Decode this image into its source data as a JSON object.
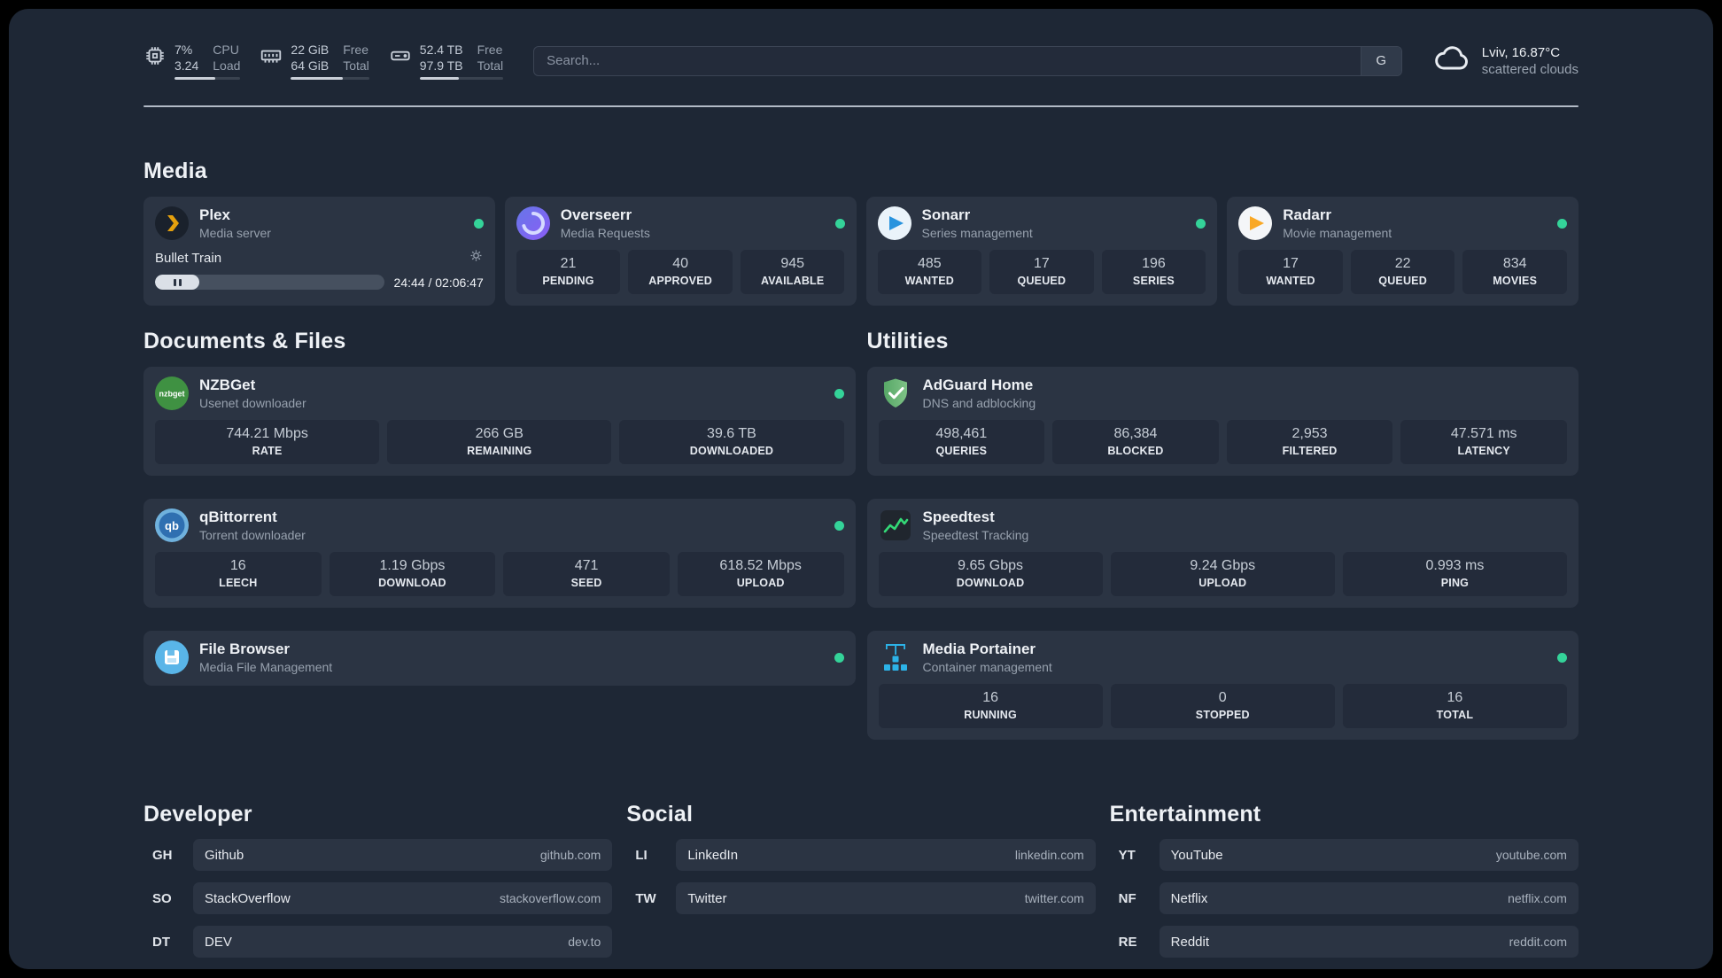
{
  "topbar": {
    "cpu": {
      "value1": "7%",
      "value2": "3.24",
      "label1": "CPU",
      "label2": "Load",
      "bar_pct": 62
    },
    "memory": {
      "value1": "22 GiB",
      "value2": "64 GiB",
      "label1": "Free",
      "label2": "Total",
      "bar_pct": 66
    },
    "disk": {
      "value1": "52.4 TB",
      "value2": "97.9 TB",
      "label1": "Free",
      "label2": "Total",
      "bar_pct": 47
    },
    "search": {
      "placeholder": "Search...",
      "provider_label": "G"
    },
    "weather": {
      "location": "Lviv, 16.87°C",
      "condition": "scattered clouds"
    }
  },
  "sections": {
    "media": {
      "title": "Media"
    },
    "documents": {
      "title": "Documents & Files"
    },
    "utilities": {
      "title": "Utilities"
    },
    "developer": {
      "title": "Developer"
    },
    "social": {
      "title": "Social"
    },
    "entertainment": {
      "title": "Entertainment"
    }
  },
  "services": {
    "plex": {
      "name": "Plex",
      "desc": "Media server",
      "now_playing": "Bullet Train",
      "time": "24:44 / 02:06:47",
      "progress_pct": 19.5
    },
    "overseerr": {
      "name": "Overseerr",
      "desc": "Media Requests",
      "stats": [
        {
          "value": "21",
          "label": "PENDING"
        },
        {
          "value": "40",
          "label": "APPROVED"
        },
        {
          "value": "945",
          "label": "AVAILABLE"
        }
      ]
    },
    "sonarr": {
      "name": "Sonarr",
      "desc": "Series management",
      "stats": [
        {
          "value": "485",
          "label": "WANTED"
        },
        {
          "value": "17",
          "label": "QUEUED"
        },
        {
          "value": "196",
          "label": "SERIES"
        }
      ]
    },
    "radarr": {
      "name": "Radarr",
      "desc": "Movie management",
      "stats": [
        {
          "value": "17",
          "label": "WANTED"
        },
        {
          "value": "22",
          "label": "QUEUED"
        },
        {
          "value": "834",
          "label": "MOVIES"
        }
      ]
    },
    "nzbget": {
      "name": "NZBGet",
      "desc": "Usenet downloader",
      "stats": [
        {
          "value": "744.21 Mbps",
          "label": "RATE"
        },
        {
          "value": "266 GB",
          "label": "REMAINING"
        },
        {
          "value": "39.6 TB",
          "label": "DOWNLOADED"
        }
      ]
    },
    "qbittorrent": {
      "name": "qBittorrent",
      "desc": "Torrent downloader",
      "stats": [
        {
          "value": "16",
          "label": "LEECH"
        },
        {
          "value": "1.19 Gbps",
          "label": "DOWNLOAD"
        },
        {
          "value": "471",
          "label": "SEED"
        },
        {
          "value": "618.52 Mbps",
          "label": "UPLOAD"
        }
      ]
    },
    "filebrowser": {
      "name": "File Browser",
      "desc": "Media File Management"
    },
    "adguard": {
      "name": "AdGuard Home",
      "desc": "DNS and adblocking",
      "stats": [
        {
          "value": "498,461",
          "label": "QUERIES"
        },
        {
          "value": "86,384",
          "label": "BLOCKED"
        },
        {
          "value": "2,953",
          "label": "FILTERED"
        },
        {
          "value": "47.571 ms",
          "label": "LATENCY"
        }
      ]
    },
    "speedtest": {
      "name": "Speedtest",
      "desc": "Speedtest Tracking",
      "stats": [
        {
          "value": "9.65 Gbps",
          "label": "DOWNLOAD"
        },
        {
          "value": "9.24 Gbps",
          "label": "UPLOAD"
        },
        {
          "value": "0.993 ms",
          "label": "PING"
        }
      ]
    },
    "portainer": {
      "name": "Media Portainer",
      "desc": "Container management",
      "stats": [
        {
          "value": "16",
          "label": "RUNNING"
        },
        {
          "value": "0",
          "label": "STOPPED"
        },
        {
          "value": "16",
          "label": "TOTAL"
        }
      ]
    }
  },
  "bookmarks": {
    "developer": [
      {
        "abbr": "GH",
        "name": "Github",
        "domain": "github.com"
      },
      {
        "abbr": "SO",
        "name": "StackOverflow",
        "domain": "stackoverflow.com"
      },
      {
        "abbr": "DT",
        "name": "DEV",
        "domain": "dev.to"
      }
    ],
    "social": [
      {
        "abbr": "LI",
        "name": "LinkedIn",
        "domain": "linkedin.com"
      },
      {
        "abbr": "TW",
        "name": "Twitter",
        "domain": "twitter.com"
      }
    ],
    "entertainment": [
      {
        "abbr": "YT",
        "name": "YouTube",
        "domain": "youtube.com"
      },
      {
        "abbr": "NF",
        "name": "Netflix",
        "domain": "netflix.com"
      },
      {
        "abbr": "RE",
        "name": "Reddit",
        "domain": "reddit.com"
      }
    ]
  },
  "colors": {
    "status_ok": "#34d399",
    "background": "#1e2735",
    "card": "#2b3443"
  }
}
